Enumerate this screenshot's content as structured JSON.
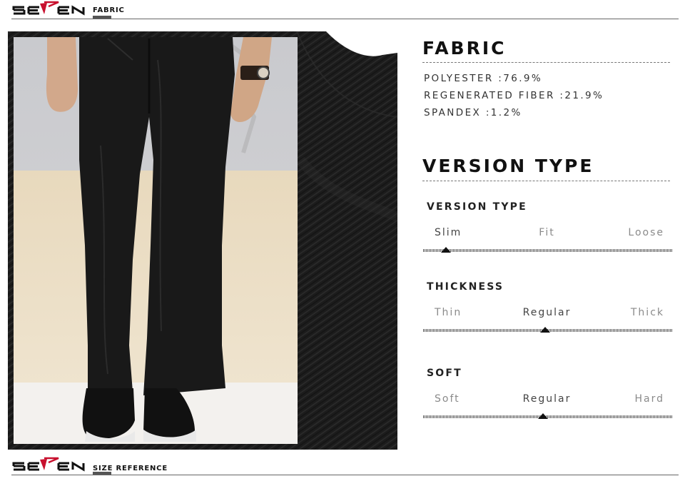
{
  "header": {
    "brand_icon": "seven-logo",
    "label": "FABRIC"
  },
  "footer": {
    "brand_icon": "seven-logo",
    "label": "SIZE REFERENCE"
  },
  "photo": {
    "description_icon": "trousers-product-photo"
  },
  "fabric": {
    "title": "FABRIC",
    "composition": [
      "POLYESTER :76.9%",
      "REGENERATED FIBER :21.9%",
      "SPANDEX :1.2%"
    ]
  },
  "version": {
    "title": "VERSION TYPE",
    "attributes": [
      {
        "label": "VERSION TYPE",
        "options": [
          "Slim",
          "Fit",
          "Loose"
        ],
        "selected": "Slim"
      },
      {
        "label": "THICKNESS",
        "options": [
          "Thin",
          "Regular",
          "Thick"
        ],
        "selected": "Regular"
      },
      {
        "label": "SOFT",
        "options": [
          "Soft",
          "Regular",
          "Hard"
        ],
        "selected": "Regular"
      }
    ]
  },
  "colors": {
    "brand_red": "#c8102e",
    "text_dark": "#111111",
    "fabric_black": "#1a1a1a"
  }
}
